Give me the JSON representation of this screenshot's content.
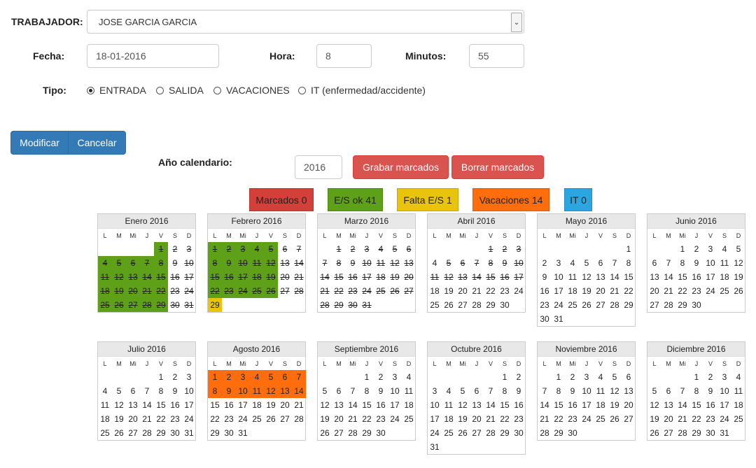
{
  "form": {
    "worker_label": "TRABAJADOR:",
    "worker_value": "JOSE GARCIA GARCIA",
    "date_label": "Fecha:",
    "date_value": "18-01-2016",
    "hour_label": "Hora:",
    "hour_value": "8",
    "minutes_label": "Minutos:",
    "minutes_value": "55",
    "type_label": "Tipo:",
    "types": [
      "ENTRADA",
      "SALIDA",
      "VACACIONES",
      "IT (enfermedad/accidente)"
    ],
    "selected_type": "ENTRADA"
  },
  "actions": {
    "modify": "Modificar",
    "cancel": "Cancelar"
  },
  "calendar_controls": {
    "year_label": "Año calendario:",
    "year_value": "2016",
    "save_marks": "Grabar marcados",
    "delete_marks": "Borrar marcados"
  },
  "legend": [
    {
      "label": "Marcados 0",
      "color": "#d43f3a",
      "text_color": "#222"
    },
    {
      "label": "E/S ok 41",
      "color": "#5fa019",
      "text_color": "#222"
    },
    {
      "label": "Falta E/S 1",
      "color": "#e8c40d",
      "text_color": "#222"
    },
    {
      "label": "Vacaciones 14",
      "color": "#ff6d0d",
      "text_color": "#222"
    },
    {
      "label": "IT 0",
      "color": "#2ba6e1",
      "text_color": "#222"
    }
  ],
  "weekdays": [
    "L",
    "M",
    "Mi",
    "J",
    "V",
    "S",
    "D"
  ],
  "months": [
    {
      "name": "Enero 2016",
      "offset": 4,
      "days": 31,
      "strike": [
        1,
        2,
        3,
        4,
        5,
        6,
        7,
        8,
        9,
        10,
        11,
        12,
        13,
        14,
        15,
        16,
        17,
        18,
        19,
        20,
        21,
        22,
        23,
        24,
        25,
        26,
        27,
        28,
        29,
        30,
        31
      ],
      "green": [
        1,
        4,
        5,
        6,
        7,
        8,
        11,
        12,
        13,
        14,
        15,
        18,
        19,
        20,
        21,
        22,
        25,
        26,
        27,
        28,
        29
      ],
      "yellow": [],
      "orange": []
    },
    {
      "name": "Febrero 2016",
      "offset": 0,
      "days": 29,
      "strike": [
        1,
        2,
        3,
        4,
        5,
        6,
        7,
        8,
        9,
        10,
        11,
        12,
        13,
        14,
        15,
        16,
        17,
        18,
        19,
        20,
        21,
        22,
        23,
        24,
        25,
        26,
        27,
        28
      ],
      "green": [
        1,
        2,
        3,
        4,
        5,
        8,
        9,
        10,
        11,
        12,
        15,
        16,
        17,
        18,
        19,
        22,
        23,
        24,
        25,
        26
      ],
      "yellow": [
        29
      ],
      "orange": []
    },
    {
      "name": "Marzo 2016",
      "offset": 1,
      "days": 31,
      "strike": [
        1,
        2,
        3,
        4,
        5,
        6,
        7,
        8,
        9,
        10,
        11,
        12,
        13,
        14,
        15,
        16,
        17,
        18,
        19,
        20,
        21,
        22,
        23,
        24,
        25,
        26,
        27,
        28,
        29,
        30,
        31
      ],
      "green": [],
      "yellow": [],
      "orange": []
    },
    {
      "name": "Abril 2016",
      "offset": 4,
      "days": 30,
      "strike": [
        1,
        2,
        3,
        5,
        6,
        7,
        8,
        9,
        10,
        11,
        12,
        13,
        14,
        15,
        16,
        17
      ],
      "green": [],
      "yellow": [],
      "orange": []
    },
    {
      "name": "Mayo 2016",
      "offset": 6,
      "days": 31,
      "strike": [],
      "green": [],
      "yellow": [],
      "orange": []
    },
    {
      "name": "Junio 2016",
      "offset": 2,
      "days": 30,
      "strike": [],
      "green": [],
      "yellow": [],
      "orange": []
    },
    {
      "name": "Julio 2016",
      "offset": 4,
      "days": 31,
      "strike": [],
      "green": [],
      "yellow": [],
      "orange": []
    },
    {
      "name": "Agosto 2016",
      "offset": 0,
      "days": 31,
      "strike": [],
      "green": [],
      "yellow": [],
      "orange": [
        1,
        2,
        3,
        4,
        5,
        6,
        7,
        8,
        9,
        10,
        11,
        12,
        13,
        14
      ]
    },
    {
      "name": "Septiembre 2016",
      "offset": 3,
      "days": 30,
      "strike": [],
      "green": [],
      "yellow": [],
      "orange": []
    },
    {
      "name": "Octubre 2016",
      "offset": 5,
      "days": 31,
      "strike": [],
      "green": [],
      "yellow": [],
      "orange": []
    },
    {
      "name": "Noviembre 2016",
      "offset": 1,
      "days": 30,
      "strike": [],
      "green": [],
      "yellow": [],
      "orange": []
    },
    {
      "name": "Diciembre 2016",
      "offset": 3,
      "days": 31,
      "strike": [],
      "green": [],
      "yellow": [],
      "orange": []
    }
  ]
}
